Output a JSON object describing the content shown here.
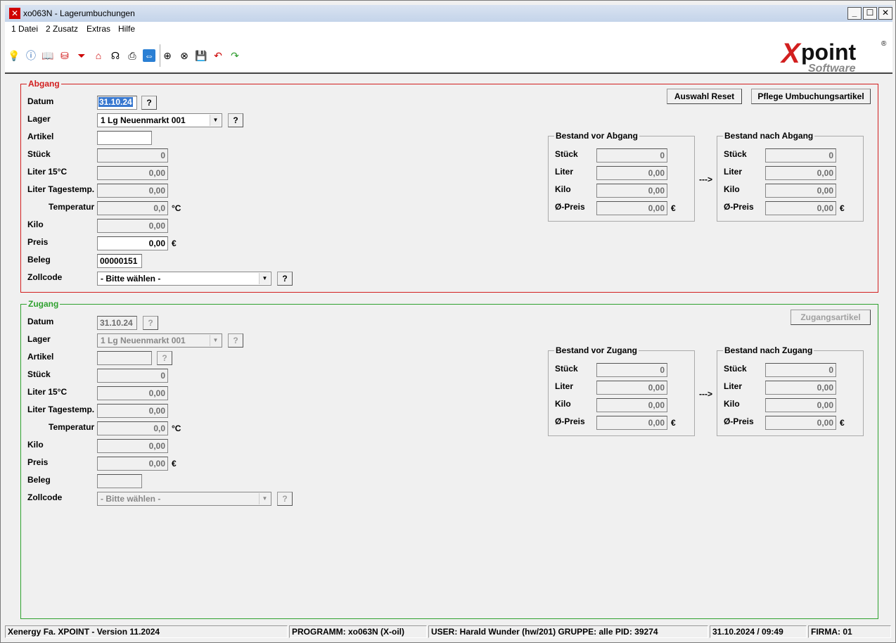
{
  "window": {
    "title": "xo063N - Lagerumbuchungen"
  },
  "menu": [
    "1 Datei",
    "2 Zusatz",
    "Extras",
    "Hilfe"
  ],
  "logo": {
    "main": "Xpoint",
    "sub": "Software",
    "reg": "®"
  },
  "abgang": {
    "title": "Abgang",
    "labels": {
      "datum": "Datum",
      "lager": "Lager",
      "artikel": "Artikel",
      "stueck": "Stück",
      "liter15": "Liter 15°C",
      "litertages": "Liter Tagestemp.",
      "temperatur": "Temperatur",
      "kilo": "Kilo",
      "preis": "Preis",
      "beleg": "Beleg",
      "zollcode": "Zollcode"
    },
    "values": {
      "datum": "31.10.24",
      "lager": "1  Lg Neuenmarkt  001",
      "artikel": "",
      "stueck": "0",
      "liter15": "0,00",
      "litertages": "0,00",
      "temperatur": "0,0",
      "kilo": "0,00",
      "preis": "0,00",
      "beleg": "00000151",
      "zollcode": "- Bitte wählen -"
    },
    "buttons": {
      "reset": "Auswahl Reset",
      "pflege": "Pflege Umbuchungsartikel"
    },
    "vor": {
      "title": "Bestand vor Abgang",
      "stueck": "0",
      "liter": "0,00",
      "kilo": "0,00",
      "preis": "0,00"
    },
    "nach": {
      "title": "Bestand nach Abgang",
      "stueck": "0",
      "liter": "0,00",
      "kilo": "0,00",
      "preis": "0,00"
    }
  },
  "zugang": {
    "title": "Zugang",
    "labels": {
      "datum": "Datum",
      "lager": "Lager",
      "artikel": "Artikel",
      "stueck": "Stück",
      "liter15": "Liter 15°C",
      "litertages": "Liter Tagestemp.",
      "temperatur": "Temperatur",
      "kilo": "Kilo",
      "preis": "Preis",
      "beleg": "Beleg",
      "zollcode": "Zollcode"
    },
    "values": {
      "datum": "31.10.24",
      "lager": "1  Lg Neuenmarkt  001",
      "artikel": "",
      "stueck": "0",
      "liter15": "0,00",
      "litertages": "0,00",
      "temperatur": "0,0",
      "kilo": "0,00",
      "preis": "0,00",
      "beleg": "",
      "zollcode": "- Bitte wählen -"
    },
    "buttons": {
      "zugangsartikel": "Zugangsartikel"
    },
    "vor": {
      "title": "Bestand vor Zugang",
      "stueck": "0",
      "liter": "0,00",
      "kilo": "0,00",
      "preis": "0,00"
    },
    "nach": {
      "title": "Bestand nach Zugang",
      "stueck": "0",
      "liter": "0,00",
      "kilo": "0,00",
      "preis": "0,00"
    }
  },
  "bestand_labels": {
    "stueck": "Stück",
    "liter": "Liter",
    "kilo": "Kilo",
    "preis": "Ø-Preis"
  },
  "common": {
    "q": "?",
    "arrow": "--->",
    "celsius": "°C",
    "euro": "€"
  },
  "status": {
    "version": "Xenergy Fa. XPOINT - Version 11.2024",
    "programm": "PROGRAMM: xo063N (X-oil)",
    "user": "USER: Harald Wunder (hw/201)  GRUPPE: alle  PID: 39274",
    "datetime": "31.10.2024 / 09:49",
    "firma": "FIRMA: 01"
  },
  "colors": {
    "abgang": "#d21f1f",
    "zugang": "#2ea12e"
  }
}
